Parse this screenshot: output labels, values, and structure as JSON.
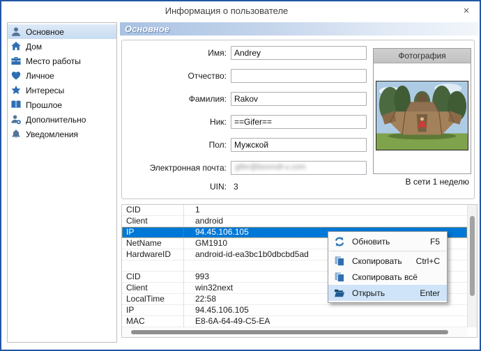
{
  "window": {
    "title": "Информация о пользователе",
    "close": "×"
  },
  "sidebar": {
    "items": [
      {
        "label": "Основное",
        "icon": "person-icon",
        "selected": true
      },
      {
        "label": "Дом",
        "icon": "home-icon"
      },
      {
        "label": "Место работы",
        "icon": "briefcase-icon"
      },
      {
        "label": "Личное",
        "icon": "heart-icon"
      },
      {
        "label": "Интересы",
        "icon": "star-icon"
      },
      {
        "label": "Прошлое",
        "icon": "book-icon"
      },
      {
        "label": "Дополнительно",
        "icon": "person-plus-icon"
      },
      {
        "label": "Уведомления",
        "icon": "bell-icon"
      }
    ]
  },
  "main": {
    "section_header": "Основное",
    "form": {
      "fields": [
        {
          "label": "Имя:",
          "value": "Andrey"
        },
        {
          "label": "Отчество:",
          "value": ""
        },
        {
          "label": "Фамилия:",
          "value": "Rakov"
        },
        {
          "label": "Ник:",
          "value": "==Gifer=="
        },
        {
          "label": "Пол:",
          "value": "Мужской"
        },
        {
          "label": "Электронная почта:",
          "value": "",
          "obscured": true,
          "obscured_placeholder": "gifer@boxmdl-u.com"
        }
      ],
      "uin": {
        "label": "UIN:",
        "value": "3"
      }
    },
    "photo": {
      "header": "Фотография",
      "status": "В сети 1 неделю",
      "description": "wooden sculpture in a park, person in red sitting in center"
    },
    "table": {
      "rows": [
        {
          "key": "CID",
          "value": "1"
        },
        {
          "key": "Client",
          "value": "android"
        },
        {
          "key": "IP",
          "value": "94.45.106.105",
          "selected": true
        },
        {
          "key": "NetName",
          "value": "GM1910"
        },
        {
          "key": "HardwareID",
          "value": "android-id-ea3bc1b0dbcbd5ad"
        },
        {
          "key": "",
          "value": ""
        },
        {
          "key": "CID",
          "value": "993"
        },
        {
          "key": "Client",
          "value": "win32next"
        },
        {
          "key": "LocalTime",
          "value": "22:58"
        },
        {
          "key": "IP",
          "value": "94.45.106.105"
        },
        {
          "key": "MAC",
          "value": "E8-6A-64-49-C5-EA"
        }
      ]
    }
  },
  "context_menu": {
    "items": [
      {
        "label": "Обновить",
        "shortcut": "F5",
        "icon": "refresh-icon"
      },
      {
        "label": "Скопировать",
        "shortcut": "Ctrl+C",
        "icon": "copy-icon"
      },
      {
        "label": "Скопировать всё",
        "shortcut": "",
        "icon": "copy-icon"
      },
      {
        "label": "Открыть",
        "shortcut": "Enter",
        "icon": "open-folder-icon",
        "highlighted": true
      }
    ]
  },
  "colors": {
    "dialog_border": "#2355a4",
    "selection_blue": "#0078d7",
    "sidebar_selected": "#c8dcf1",
    "menu_highlight": "#cfe4f8",
    "icon_blue": "#2e6fb3"
  }
}
